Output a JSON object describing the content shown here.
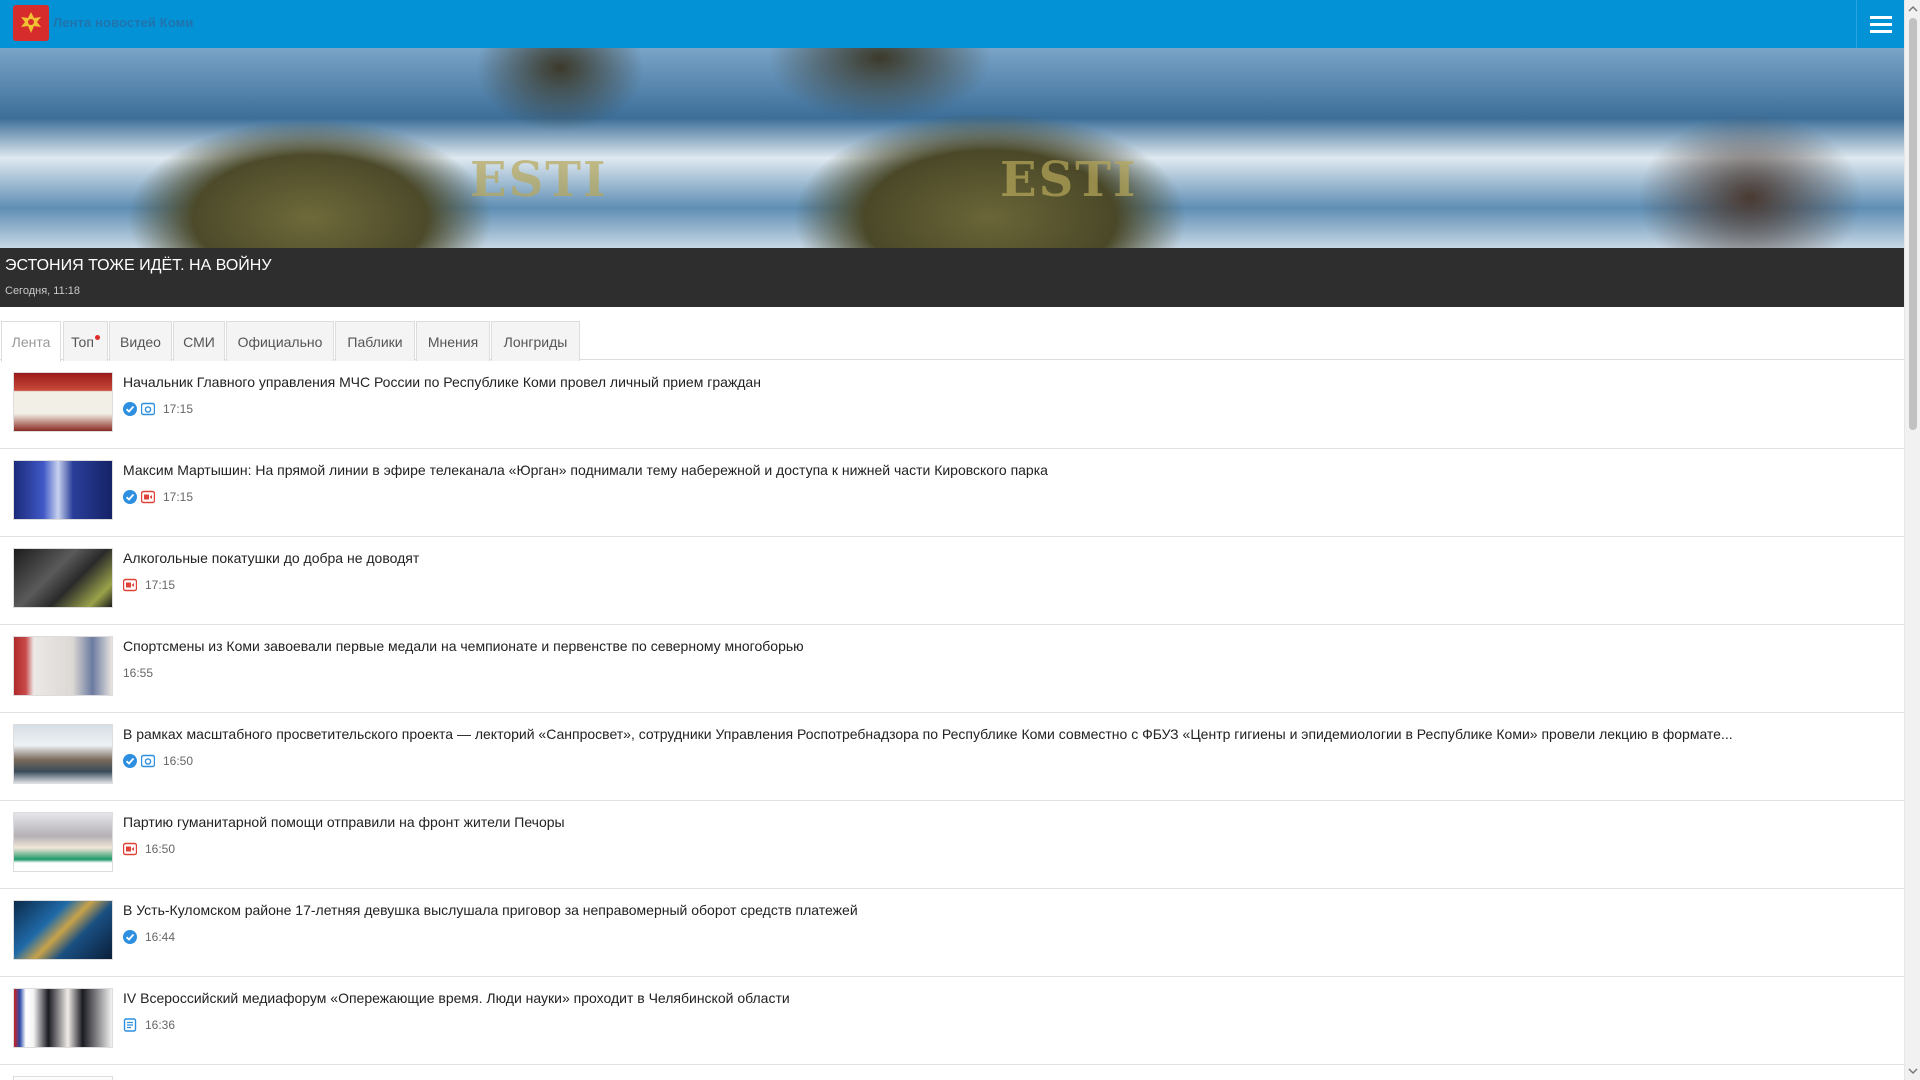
{
  "header": {
    "site_title": "Лента новостей Коми",
    "menu_icon": "hamburger-menu-icon",
    "logo_icon": "komi-coat-of-arms-icon",
    "colors": {
      "bar": "#0492d6",
      "logo": "#d72c2c"
    }
  },
  "hero": {
    "title": "ЭСТОНИЯ ТОЖЕ ИДЁТ. НА ВОЙНУ",
    "date": "Сегодня, 11:18",
    "image_text": "ESTI"
  },
  "tabs": [
    {
      "label": "Лента",
      "active": true
    },
    {
      "label": "Топ",
      "badge": true
    },
    {
      "label": "Видео"
    },
    {
      "label": "СМИ"
    },
    {
      "label": "Официально"
    },
    {
      "label": "Паблики"
    },
    {
      "label": "Мнения"
    },
    {
      "label": "Лонгриды"
    }
  ],
  "feed": [
    {
      "title": "Начальник Главного управления МЧС России по Республике Коми провел личный прием граждан",
      "time": "17:15",
      "icons": [
        "verified-icon",
        "photo-icon"
      ]
    },
    {
      "title": "Максим Мартышин: На прямой линии в эфире телеканала «Юрган» поднимали тему набережной и доступа к нижней части Кировского парка",
      "time": "17:15",
      "icons": [
        "verified-icon",
        "video-icon"
      ]
    },
    {
      "title": "Алкогольные покатушки до добра не доводят",
      "time": "17:15",
      "icons": [
        "video-icon"
      ]
    },
    {
      "title": "Спортсмены из Коми завоевали первые медали на чемпионате и первенстве по северному многоборью",
      "time": "16:55",
      "icons": []
    },
    {
      "title": "В рамках масштабного просветительского проекта — лекторий «Санпросвет», сотрудники Управления Роспотребнадзора по Республике Коми совместно с ФБУЗ «Центр гигиены и эпидемиологии в Республике Коми» провели лекцию в формате...",
      "time": "16:50",
      "icons": [
        "verified-icon",
        "photo-icon"
      ]
    },
    {
      "title": "Партию гуманитарной помощи отправили на фронт жители Печоры",
      "time": "16:50",
      "icons": [
        "video-icon"
      ]
    },
    {
      "title": "В Усть-Куломском районе 17-летняя девушка выслушала приговор за неправомерный оборот средств платежей",
      "time": "16:44",
      "icons": [
        "verified-icon"
      ]
    },
    {
      "title": "IV Всероссийский медиафорум «Опережающие время. Люди науки» проходит в Челябинской области",
      "time": "16:36",
      "icons": [
        "document-icon"
      ]
    }
  ]
}
